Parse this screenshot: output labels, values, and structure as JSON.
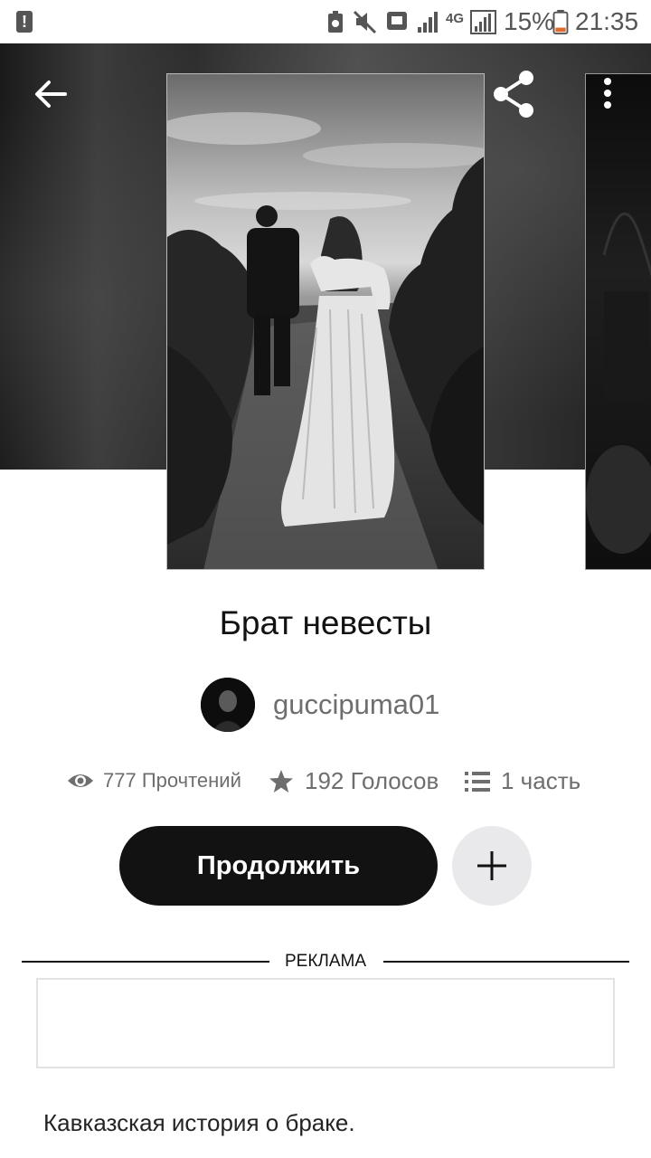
{
  "status_bar": {
    "battery": "15%",
    "time": "21:35",
    "network": "4G"
  },
  "story": {
    "title": "Брат невесты",
    "author": "guccipuma01",
    "reads": "777 Прочтений",
    "votes": "192 Голосов",
    "parts": "1 часть",
    "description": "Кавказская история о браке."
  },
  "actions": {
    "continue_label": "Продолжить"
  },
  "ad": {
    "label": "РЕКЛАМА"
  },
  "colors": {
    "primary_button": "#121212",
    "secondary_button": "#e9e8ea",
    "muted_text": "#6e6e6e"
  },
  "icons": [
    "back-arrow-icon",
    "share-icon",
    "more-vert-icon",
    "eye-icon",
    "star-icon",
    "list-icon",
    "plus-icon"
  ]
}
